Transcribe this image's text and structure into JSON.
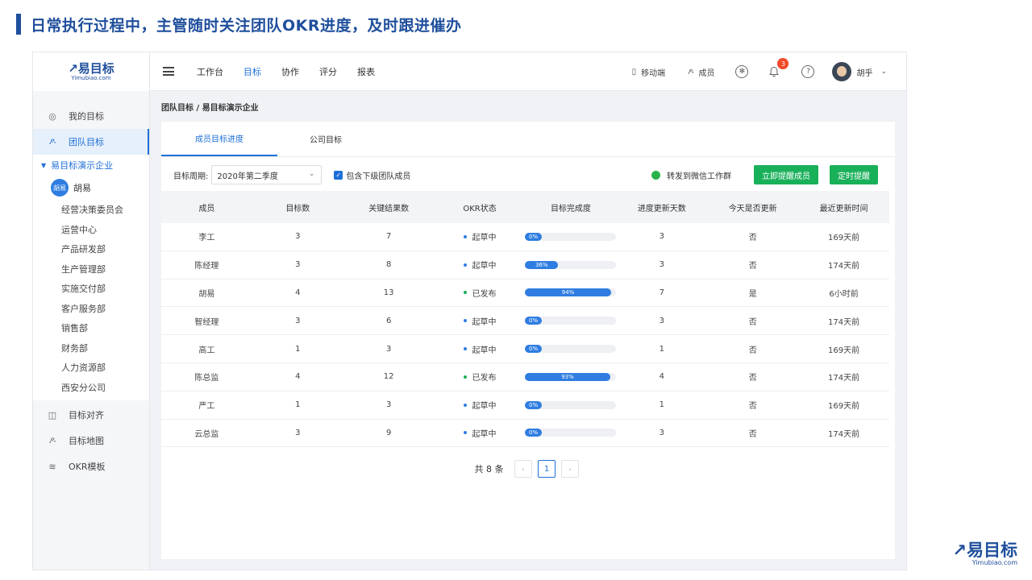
{
  "slide_title": "日常执行过程中，主管随时关注团队OKR进度，及时跟进催办",
  "logo": {
    "main": "↗易目标",
    "sub": "Yimubiao.com"
  },
  "corner_logo": {
    "main": "↗易目标",
    "sub": "Yimubiao.com"
  },
  "sidebar": {
    "nav_top": [
      {
        "label": "我的目标",
        "icon": "target-icon"
      },
      {
        "label": "团队目标",
        "icon": "team-icon",
        "active": true
      }
    ],
    "tree_root": "易目标演示企业",
    "tree_user": {
      "avatar": "胡易",
      "name": "胡易"
    },
    "departments": [
      "经营决策委员会",
      "运营中心",
      "产品研发部",
      "生产管理部",
      "实施交付部",
      "客户服务部",
      "销售部",
      "财务部",
      "人力资源部",
      "西安分公司"
    ],
    "nav_bottom": [
      {
        "label": "目标对齐",
        "icon": "align-icon"
      },
      {
        "label": "目标地图",
        "icon": "map-icon"
      },
      {
        "label": "OKR模板",
        "icon": "layers-icon"
      }
    ]
  },
  "topnav": {
    "tabs": [
      "工作台",
      "目标",
      "协作",
      "评分",
      "报表"
    ],
    "active_tab": "目标",
    "mobile": "移动端",
    "members": "成员",
    "notification_count": "3",
    "help": "?",
    "user_name": "胡乎",
    "chevron": "⌄"
  },
  "breadcrumb": "团队目标 / 易目标演示企业",
  "tabs": [
    "成员目标进度",
    "公司目标"
  ],
  "filter": {
    "period_label": "目标周期:",
    "period_value": "2020年第二季度",
    "include_label": "包含下级团队成员",
    "wechat_label": "转发到微信工作群",
    "remind_now": "立即提醒成员",
    "schedule_remind": "定时提醒"
  },
  "table": {
    "headers": [
      "成员",
      "目标数",
      "关键结果数",
      "OKR状态",
      "目标完成度",
      "进度更新天数",
      "今天是否更新",
      "最近更新时间"
    ],
    "rows": [
      {
        "name": "李工",
        "objectives": "3",
        "krs": "7",
        "status": "起草中",
        "status_color": "#2f7de1",
        "progress": 0,
        "progress_label": "0%",
        "days": "3",
        "updated_today": "否",
        "last": "169天前"
      },
      {
        "name": "陈经理",
        "objectives": "3",
        "krs": "8",
        "status": "起草中",
        "status_color": "#2f7de1",
        "progress": 36,
        "progress_label": "36%",
        "days": "3",
        "updated_today": "否",
        "last": "174天前"
      },
      {
        "name": "胡易",
        "objectives": "4",
        "krs": "13",
        "status": "已发布",
        "status_color": "#19b05a",
        "progress": 94,
        "progress_label": "94%",
        "days": "7",
        "updated_today": "是",
        "last": "6小时前"
      },
      {
        "name": "智经理",
        "objectives": "3",
        "krs": "6",
        "status": "起草中",
        "status_color": "#2f7de1",
        "progress": 0,
        "progress_label": "0%",
        "days": "3",
        "updated_today": "否",
        "last": "174天前"
      },
      {
        "name": "高工",
        "objectives": "1",
        "krs": "3",
        "status": "起草中",
        "status_color": "#2f7de1",
        "progress": 0,
        "progress_label": "0%",
        "days": "1",
        "updated_today": "否",
        "last": "169天前"
      },
      {
        "name": "陈总监",
        "objectives": "4",
        "krs": "12",
        "status": "已发布",
        "status_color": "#19b05a",
        "progress": 93,
        "progress_label": "93%",
        "days": "4",
        "updated_today": "否",
        "last": "174天前"
      },
      {
        "name": "严工",
        "objectives": "1",
        "krs": "3",
        "status": "起草中",
        "status_color": "#2f7de1",
        "progress": 0,
        "progress_label": "0%",
        "days": "1",
        "updated_today": "否",
        "last": "169天前"
      },
      {
        "name": "云总监",
        "objectives": "3",
        "krs": "9",
        "status": "起草中",
        "status_color": "#2f7de1",
        "progress": 0,
        "progress_label": "0%",
        "days": "3",
        "updated_today": "否",
        "last": "174天前"
      }
    ]
  },
  "pagination": {
    "total": "共 8 条",
    "prev": "‹",
    "current": "1",
    "next": "›"
  }
}
